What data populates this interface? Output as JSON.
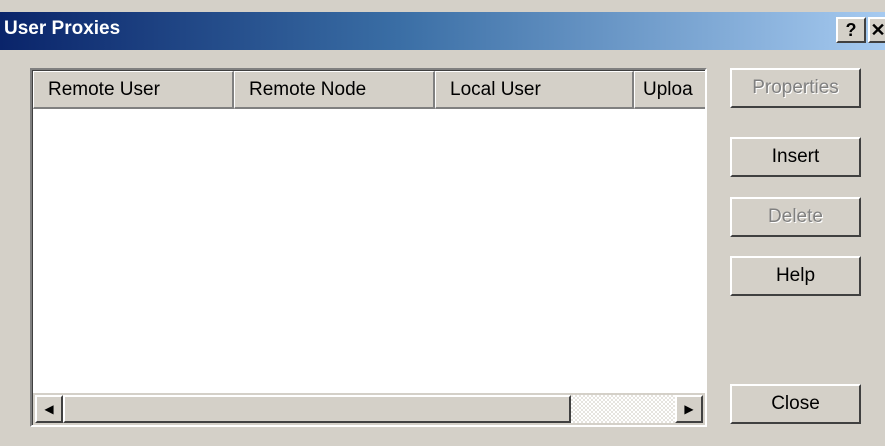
{
  "window": {
    "title": "User Proxies",
    "help_button": "?",
    "close_button": "✕"
  },
  "list": {
    "columns": [
      "Remote User",
      "Remote Node",
      "Local User",
      "Uploa"
    ],
    "rows": []
  },
  "scrollbar": {
    "left_arrow": "◀",
    "right_arrow": "▶"
  },
  "buttons": {
    "properties": "Properties",
    "insert": "Insert",
    "delete": "Delete",
    "help": "Help",
    "close": "Close"
  }
}
